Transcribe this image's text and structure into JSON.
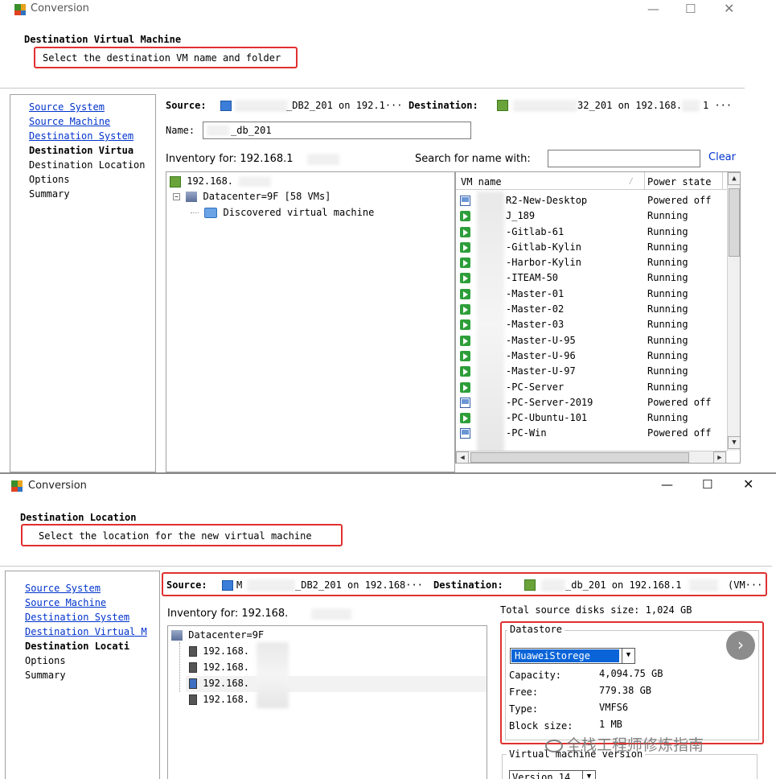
{
  "w1": {
    "title": "Conversion",
    "heading": "Destination Virtual Machine",
    "subheading": "Select the destination VM name and folder",
    "nav": [
      "Source System",
      "Source Machine",
      "Destination System",
      "Destination Virtua",
      "Destination Location",
      "Options",
      "Summary"
    ],
    "source_label": "Source:",
    "source_value": "_DB2_201 on 192.1···",
    "destination_label": "Destination:",
    "destination_value": "32_201 on 192.168.",
    "destination_tail": "1 ···",
    "name_label": "Name:",
    "name_value": "_db_201",
    "inventory_label": "Inventory for: 192.168.1",
    "search_label": "Search for name with:",
    "search_value": "",
    "clear_link": "Clear",
    "tree_root": "192.168.",
    "tree_datacenter": "Datacenter=9F [58 VMs]",
    "tree_folder": "Discovered virtual machine",
    "col_vm_name": "VM name",
    "col_power_state": "Power state",
    "vms": [
      {
        "name": "R2-New-Desktop",
        "state": "Powered off",
        "on": false
      },
      {
        "name": "J_189",
        "state": "Running",
        "on": true
      },
      {
        "name": "-Gitlab-61",
        "state": "Running",
        "on": true
      },
      {
        "name": "-Gitlab-Kylin",
        "state": "Running",
        "on": true
      },
      {
        "name": "-Harbor-Kylin",
        "state": "Running",
        "on": true
      },
      {
        "name": "-ITEAM-50",
        "state": "Running",
        "on": true
      },
      {
        "name": "-Master-01",
        "state": "Running",
        "on": true
      },
      {
        "name": "-Master-02",
        "state": "Running",
        "on": true
      },
      {
        "name": "-Master-03",
        "state": "Running",
        "on": true
      },
      {
        "name": "-Master-U-95",
        "state": "Running",
        "on": true
      },
      {
        "name": "-Master-U-96",
        "state": "Running",
        "on": true
      },
      {
        "name": "-Master-U-97",
        "state": "Running",
        "on": true
      },
      {
        "name": "-PC-Server",
        "state": "Running",
        "on": true
      },
      {
        "name": "-PC-Server-2019",
        "state": "Powered off",
        "on": false
      },
      {
        "name": "-PC-Ubuntu-101",
        "state": "Running",
        "on": true
      },
      {
        "name": "-PC-Win",
        "state": "Powered off",
        "on": false
      }
    ]
  },
  "w2": {
    "title": "Conversion",
    "heading": "Destination Location",
    "subheading": "Select the location for the new virtual machine",
    "nav": [
      "Source System",
      "Source Machine",
      "Destination System",
      "Destination Virtual M",
      "Destination Locati",
      "Options",
      "Summary"
    ],
    "source_label": "Source:",
    "source_value": "_DB2_201 on 192.168···",
    "destination_label": "Destination:",
    "destination_value": "_db_201 on 192.168.1",
    "destination_tail": "(VM···",
    "inventory_label": "Inventory for: 192.168.",
    "tree_datacenter": "Datacenter=9F",
    "hosts": [
      "192.168.",
      "192.168.",
      "192.168.",
      "192.168."
    ],
    "total_disks": "Total source disks size: 1,024 GB",
    "datastore_group": "Datastore",
    "datastore_selected": "HuaweiStorege",
    "capacity_label": "Capacity:",
    "capacity_value": "4,094.75 GB",
    "free_label": "Free:",
    "free_value": "779.38 GB",
    "type_label": "Type:",
    "type_value": "VMFS6",
    "block_label": "Block size:",
    "block_value": "1 MB",
    "vm_version_group": "Virtual machine version",
    "vm_version_selected": "Version 14",
    "watermark": "全栈工程师修炼指南"
  }
}
